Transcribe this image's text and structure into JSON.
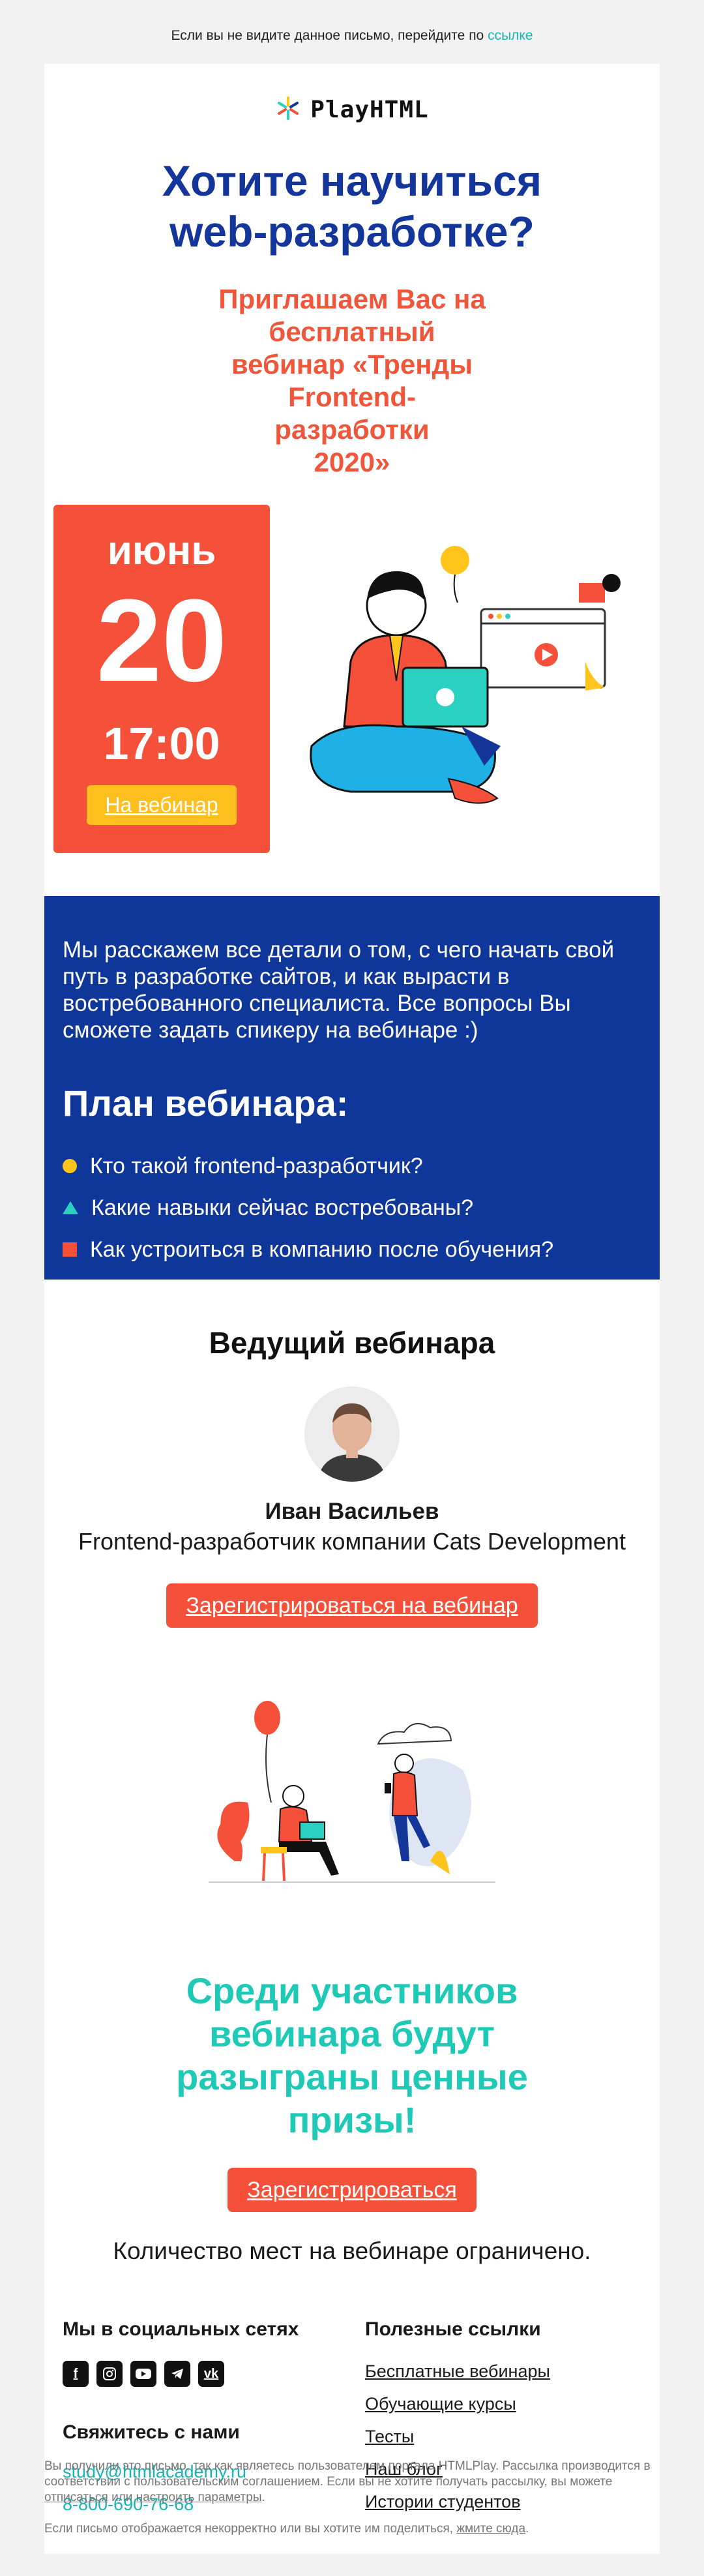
{
  "preheader": {
    "text": "Если вы не видите данное письмо, перейдите по ",
    "link": "ссылке"
  },
  "logo": {
    "text": "PlayHTML",
    "icon": "playhtml-logo-icon"
  },
  "headline": "Хотите научиться web-разработке?",
  "subtitle": [
    "Приглашаем Вас на бесплатный",
    "вебинар «Тренды Frontend-",
    "разработки",
    "2020»"
  ],
  "event": {
    "month": "июнь",
    "day": "20",
    "time": "17:00",
    "button": "На вебинар"
  },
  "about": {
    "text": "Мы расскажем все детали о том, с чего начать свой путь в разработке сайтов, и как вырасти в востребованного специалиста. Все вопросы Вы сможете задать спикеру на вебинаре :)",
    "plan_title": "План вебинара:",
    "plan": [
      "Кто такой frontend-разработчик?",
      "Какие навыки сейчас востребованы?",
      "Как устроиться в компанию после обучения?"
    ],
    "marker_colors": [
      "#ffc51c",
      "#2ad0c0",
      "#f4503a"
    ]
  },
  "speaker": {
    "title": "Ведущий вебинара",
    "name": "Иван Васильев",
    "role": "Frontend-разработчик компании Cats Development",
    "button": "Зарегистрироваться на вебинар"
  },
  "prizes": {
    "title": "Среди участников вебинара будут разыграны ценные призы!",
    "button": "Зарегистрироваться",
    "note": "Количество мест на вебинаре ограничено."
  },
  "footer": {
    "social_title": "Мы в социальных сетях",
    "social_icons": [
      "facebook-icon",
      "instagram-icon",
      "youtube-icon",
      "telegram-icon",
      "vk-icon"
    ],
    "contact_title": "Свяжитесь с нами",
    "email": "study@htmlacademy.ru",
    "phone": "8-800-690-76-68",
    "links_title": "Полезные ссылки",
    "links": [
      "Бесплатные вебинары",
      "Обучающие курсы",
      "Тесты",
      "Наш блог",
      "Истории студентов"
    ]
  },
  "disclaimer": {
    "p1_a": "Вы получили это письмо, так как являетесь пользователем портала HTMLPlay. Рассылка производится в соответствии с пользовательским соглашением. Если вы не хотите получать рассылку, вы можете ",
    "unsubscribe": "отписаться",
    "p1_b": " или ",
    "settings": "настроить параметры",
    "p1_c": ".",
    "p2_a": "Если письмо отображается некорректно или вы хотите им поделиться, ",
    "p2_link": "жмите сюда",
    "p2_b": "."
  },
  "colors": {
    "brand_blue": "#0f3699",
    "accent_red": "#f4503a",
    "accent_teal": "#1ecab6",
    "accent_yellow": "#ffbf1f"
  }
}
